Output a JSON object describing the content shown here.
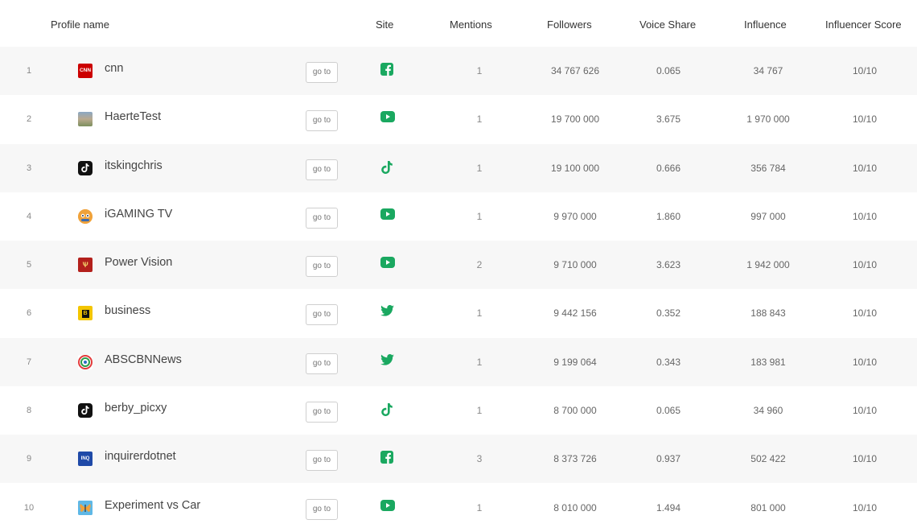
{
  "header": {
    "profile_name": "Profile name",
    "site": "Site",
    "mentions": "Mentions",
    "followers": "Followers",
    "voice_share": "Voice Share",
    "influence": "Influence",
    "influencer_score": "Influencer Score"
  },
  "goto_label": "go to",
  "colors": {
    "site_icon": "#1aa860",
    "row_alt": "#f7f7f7"
  },
  "rows": [
    {
      "num": "1",
      "name": "cnn",
      "avatar": "cnn-logo-icon",
      "avatar_text": "CNN",
      "site": "facebook-icon",
      "mentions": "1",
      "followers": "34 767 626",
      "voice_share": "0.065",
      "influence": "34 767",
      "score": "10/10"
    },
    {
      "num": "2",
      "name": "HaerteTest",
      "avatar": "photo-avatar-icon",
      "avatar_text": "",
      "site": "youtube-icon",
      "mentions": "1",
      "followers": "19 700 000",
      "voice_share": "3.675",
      "influence": "1 970 000",
      "score": "10/10"
    },
    {
      "num": "3",
      "name": "itskingchris",
      "avatar": "tiktok-logo-icon",
      "avatar_text": "",
      "site": "tiktok-icon",
      "mentions": "1",
      "followers": "19 100 000",
      "voice_share": "0.666",
      "influence": "356 784",
      "score": "10/10"
    },
    {
      "num": "4",
      "name": "iGAMING TV",
      "avatar": "igaming-logo-icon",
      "avatar_text": "",
      "site": "youtube-icon",
      "mentions": "1",
      "followers": "9 970 000",
      "voice_share": "1.860",
      "influence": "997 000",
      "score": "10/10"
    },
    {
      "num": "5",
      "name": "Power Vision",
      "avatar": "power-vision-logo-icon",
      "avatar_text": "",
      "site": "youtube-icon",
      "mentions": "2",
      "followers": "9 710 000",
      "voice_share": "3.623",
      "influence": "1 942 000",
      "score": "10/10"
    },
    {
      "num": "6",
      "name": "business",
      "avatar": "bloomberg-logo-icon",
      "avatar_text": "B",
      "site": "twitter-icon",
      "mentions": "1",
      "followers": "9 442 156",
      "voice_share": "0.352",
      "influence": "188 843",
      "score": "10/10"
    },
    {
      "num": "7",
      "name": "ABSCBNNews",
      "avatar": "abscbn-logo-icon",
      "avatar_text": "",
      "site": "twitter-icon",
      "mentions": "1",
      "followers": "9 199 064",
      "voice_share": "0.343",
      "influence": "183 981",
      "score": "10/10"
    },
    {
      "num": "8",
      "name": "berby_picxy",
      "avatar": "tiktok-logo-icon",
      "avatar_text": "",
      "site": "tiktok-icon",
      "mentions": "1",
      "followers": "8 700 000",
      "voice_share": "0.065",
      "influence": "34 960",
      "score": "10/10"
    },
    {
      "num": "9",
      "name": "inquirerdotnet",
      "avatar": "inquirer-logo-icon",
      "avatar_text": "INQ",
      "site": "facebook-icon",
      "mentions": "3",
      "followers": "8 373 726",
      "voice_share": "0.937",
      "influence": "502 422",
      "score": "10/10"
    },
    {
      "num": "10",
      "name": "Experiment vs Car",
      "avatar": "butterfly-logo-icon",
      "avatar_text": "",
      "site": "youtube-icon",
      "mentions": "1",
      "followers": "8 010 000",
      "voice_share": "1.494",
      "influence": "801 000",
      "score": "10/10"
    }
  ]
}
